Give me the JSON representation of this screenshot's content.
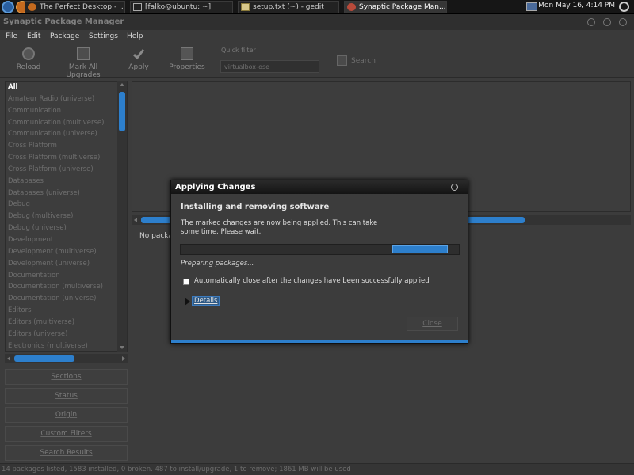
{
  "taskbar": {
    "tasks": [
      {
        "label": "The Perfect Desktop - ...",
        "active": false
      },
      {
        "label": "[falko@ubuntu: ~]",
        "active": false
      },
      {
        "label": "setup.txt (~) - gedit",
        "active": false
      },
      {
        "label": "Synaptic Package Man...",
        "active": true
      }
    ],
    "clock": "Mon May 16,  4:14 PM"
  },
  "window": {
    "title": "Synaptic Package Manager"
  },
  "menubar": {
    "items": [
      "File",
      "Edit",
      "Package",
      "Settings",
      "Help"
    ]
  },
  "toolbar": {
    "reload_label": "Reload",
    "mark_all_label": "Mark All Upgrades",
    "apply_label": "Apply",
    "properties_label": "Properties",
    "quick_filter_label": "Quick filter",
    "quick_filter_value": "virtualbox-ose",
    "search_label": "Search"
  },
  "categories": [
    "All",
    "Amateur Radio (universe)",
    "Communication",
    "Communication (multiverse)",
    "Communication (universe)",
    "Cross Platform",
    "Cross Platform (multiverse)",
    "Cross Platform (universe)",
    "Databases",
    "Databases (universe)",
    "Debug",
    "Debug (multiverse)",
    "Debug (universe)",
    "Development",
    "Development (multiverse)",
    "Development (universe)",
    "Documentation",
    "Documentation (multiverse)",
    "Documentation (universe)",
    "Editors",
    "Editors (multiverse)",
    "Editors (universe)",
    "Electronics (multiverse)"
  ],
  "side_buttons": [
    "Sections",
    "Status",
    "Origin",
    "Custom Filters",
    "Search Results"
  ],
  "details": {
    "no_package": "No packa"
  },
  "statusbar": {
    "text": "14 packages listed, 1583 installed, 0 broken. 487 to install/upgrade, 1 to remove; 1861 MB will be used"
  },
  "dialog": {
    "title": "Applying Changes",
    "heading": "Installing and removing software",
    "message": "The marked changes are now being applied. This can take some time. Please wait.",
    "progress_status": "Preparing packages...",
    "auto_close_label": "Automatically close after the changes have been successfully applied",
    "auto_close_checked": false,
    "details_label": "Details",
    "close_label": "Close"
  },
  "colors": {
    "accent": "#2d7fcc",
    "background": "#3c3c3c"
  }
}
